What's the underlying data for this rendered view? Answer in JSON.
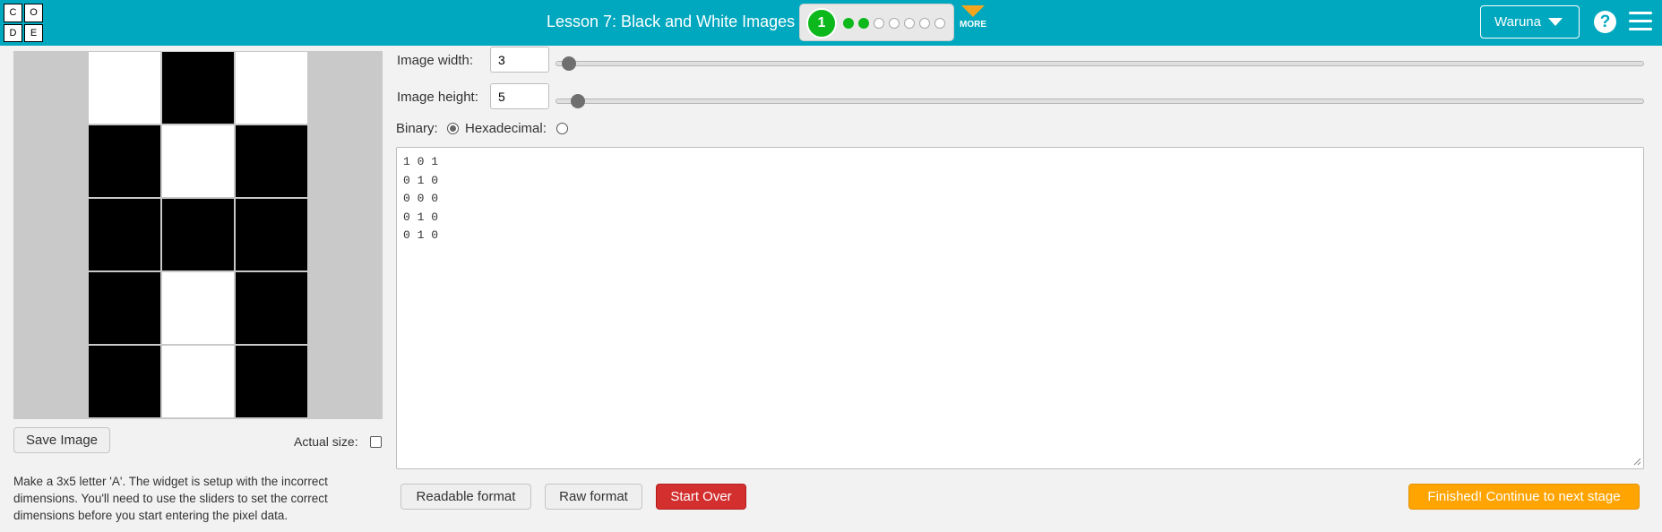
{
  "header": {
    "logo_letters": [
      "C",
      "O",
      "D",
      "E"
    ],
    "lesson_title": "Lesson 7: Black and White Images",
    "current_level": "1",
    "level_states": [
      "done",
      "done",
      "todo",
      "todo",
      "todo",
      "todo",
      "todo"
    ],
    "more_label": "MORE",
    "user_name": "Waruna",
    "help_symbol": "?",
    "accent_color": "#00a8bf",
    "more_color": "#f5a51d",
    "complete_color": "#0cb81c"
  },
  "pixel_grid": {
    "columns": 3,
    "rows": [
      [
        1,
        0,
        1
      ],
      [
        0,
        1,
        0
      ],
      [
        0,
        0,
        0
      ],
      [
        0,
        1,
        0
      ],
      [
        0,
        1,
        0
      ]
    ],
    "note_1_is_white": true
  },
  "left_panel": {
    "save_button": "Save Image",
    "actual_size_label": "Actual size:",
    "actual_size_checked": false,
    "instructions": "Make a 3x5 letter 'A'. The widget is setup with the incorrect dimensions. You'll need to use the sliders to set the correct dimensions before you start entering the pixel data."
  },
  "controls": {
    "width_label": "Image width:",
    "width_value": "3",
    "width_slider_fraction": 0.0,
    "height_label": "Image height:",
    "height_value": "5",
    "height_slider_fraction": 0.01,
    "binary_label": "Binary:",
    "hex_label": "Hexadecimal:",
    "format_selected": "binary"
  },
  "data_text": "1 0 1\n0 1 0\n0 0 0\n0 1 0\n0 1 0",
  "buttons": {
    "readable": "Readable format",
    "raw": "Raw format",
    "start_over": "Start Over",
    "finish": "Finished! Continue to next stage"
  }
}
